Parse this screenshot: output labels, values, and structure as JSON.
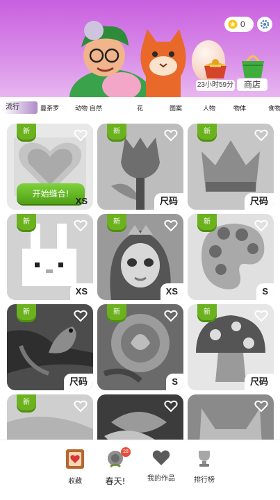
{
  "header": {
    "coins": "0",
    "timer": "23小时59分",
    "shop_label": "商店"
  },
  "tabs": {
    "items": [
      "流行",
      "曼荼罗",
      "动物 自然",
      "花",
      "图案",
      "人物",
      "物体",
      "食物"
    ]
  },
  "cards": [
    {
      "badge": "新",
      "size": "XS",
      "button": "开始缝合!"
    },
    {
      "badge": "新",
      "size": "尺码"
    },
    {
      "badge": "新",
      "size": "尺码"
    },
    {
      "badge": "新",
      "size": "XS"
    },
    {
      "badge": "新",
      "size": "XS"
    },
    {
      "badge": "新",
      "size": "S"
    },
    {
      "badge": "新",
      "size": "尺码"
    },
    {
      "badge": "新",
      "size": "S"
    },
    {
      "badge": "新",
      "size": "尺码"
    },
    {
      "badge": "新",
      "size": ""
    },
    {
      "badge": "",
      "size": ""
    },
    {
      "badge": "",
      "size": ""
    }
  ],
  "bottom_nav": {
    "items": [
      {
        "label": "收藏",
        "icon": "collection-heart-icon"
      },
      {
        "label": "春天!",
        "icon": "spring-flower-icon",
        "badge": "28"
      },
      {
        "label": "我的作品",
        "icon": "heart-icon"
      },
      {
        "label": "排行榜",
        "icon": "trophy-icon"
      }
    ]
  },
  "colors": {
    "header_top": "#c95fe0",
    "new_badge": "#6cb21f",
    "start_button": "#5fb420",
    "notification": "#e74c3c"
  }
}
